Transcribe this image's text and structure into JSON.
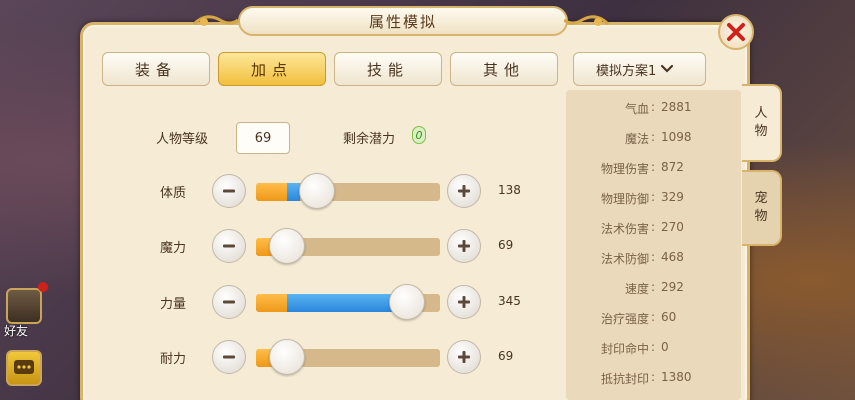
{
  "window": {
    "title": "属性模拟"
  },
  "side_ui": {
    "friend_label": "好友"
  },
  "tabs": [
    {
      "label": "装备",
      "active": false
    },
    {
      "label": "加点",
      "active": true
    },
    {
      "label": "技能",
      "active": false
    },
    {
      "label": "其他",
      "active": false
    }
  ],
  "plan_select": {
    "label": "模拟方案1"
  },
  "level": {
    "label": "人物等级",
    "value": "69"
  },
  "potential": {
    "label": "剩余潜力",
    "value": "0"
  },
  "attributes": [
    {
      "label": "体质",
      "value": "138",
      "orange_fraction": 0.17,
      "blue_fraction": 0.07,
      "knob_fraction": 0.33
    },
    {
      "label": "魔力",
      "value": "69",
      "orange_fraction": 0.17,
      "blue_fraction": 0.0,
      "knob_fraction": 0.17
    },
    {
      "label": "力量",
      "value": "345",
      "orange_fraction": 0.17,
      "blue_fraction": 0.65,
      "knob_fraction": 0.82
    },
    {
      "label": "耐力",
      "value": "69",
      "orange_fraction": 0.17,
      "blue_fraction": 0.0,
      "knob_fraction": 0.17
    }
  ],
  "stats": [
    {
      "label": "气血",
      "value": "2881"
    },
    {
      "label": "魔法",
      "value": "1098"
    },
    {
      "label": "物理伤害",
      "value": "872"
    },
    {
      "label": "物理防御",
      "value": "329"
    },
    {
      "label": "法术伤害",
      "value": "270"
    },
    {
      "label": "法术防御",
      "value": "468"
    },
    {
      "label": "速度",
      "value": "292"
    },
    {
      "label": "治疗强度",
      "value": "60"
    },
    {
      "label": "封印命中",
      "value": "0"
    },
    {
      "label": "抵抗封印",
      "value": "1380"
    }
  ],
  "side_tabs": [
    {
      "label_1": "人",
      "label_2": "物",
      "active": true
    },
    {
      "label_1": "宠",
      "label_2": "物",
      "active": false
    }
  ],
  "colors": {
    "orange": "#ee9818",
    "blue": "#2a86dc",
    "track": "#d6b98a",
    "close": "#d0201a"
  }
}
